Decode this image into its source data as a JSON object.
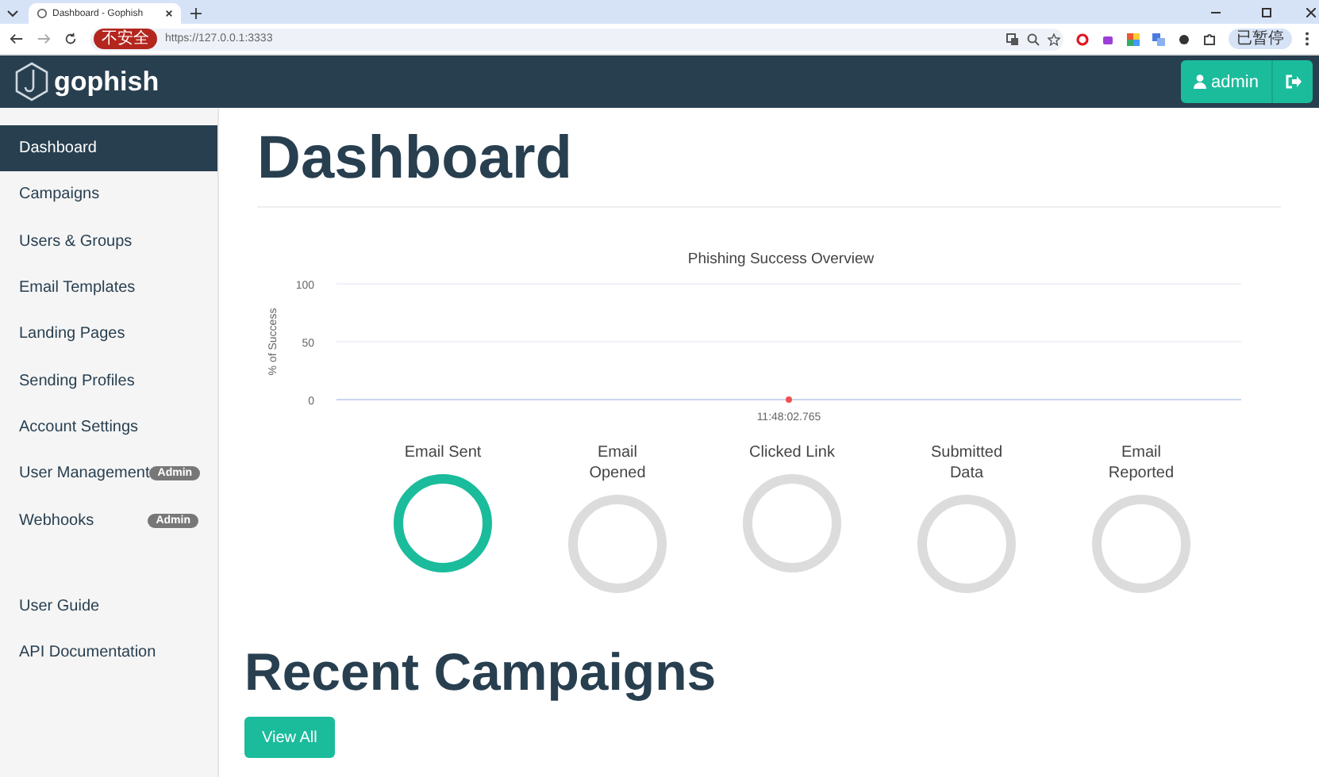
{
  "browser": {
    "tab_title": "Dashboard - Gophish",
    "security_badge": "不安全",
    "url": "https://127.0.0.1:3333",
    "profile": "已暂停"
  },
  "header": {
    "brand": "gophish",
    "user": "admin"
  },
  "sidebar": {
    "items": [
      {
        "label": "Dashboard",
        "selected": true
      },
      {
        "label": "Campaigns",
        "selected": false
      },
      {
        "label": "Users & Groups",
        "selected": false
      },
      {
        "label": "Email Templates",
        "selected": false
      },
      {
        "label": "Landing Pages",
        "selected": false
      },
      {
        "label": "Sending Profiles",
        "selected": false
      },
      {
        "label": "Account Settings",
        "selected": false
      },
      {
        "label": "User Management",
        "selected": false,
        "badge": "Admin"
      },
      {
        "label": "Webhooks",
        "selected": false,
        "badge": "Admin"
      }
    ],
    "links": [
      {
        "label": "User Guide"
      },
      {
        "label": "API Documentation"
      }
    ]
  },
  "page_title": "Dashboard",
  "overview": {
    "chart_data": {
      "type": "line",
      "title": "Phishing Success Overview",
      "ylabel": "% of Success",
      "categories": [
        "11:48:02.765"
      ],
      "series": [
        {
          "color": "#f05050",
          "marker": "circle",
          "values": [
            0
          ]
        }
      ],
      "ylim": [
        0,
        100
      ],
      "yticks": [
        0,
        50,
        100
      ]
    }
  },
  "stats": [
    {
      "label": "Email Sent",
      "color": "#1abc9c"
    },
    {
      "label": "Email Opened",
      "color": "#dcdcdc"
    },
    {
      "label": "Clicked Link",
      "color": "#dcdcdc"
    },
    {
      "label": "Submitted Data",
      "color": "#dcdcdc"
    },
    {
      "label": "Email Reported",
      "color": "#dcdcdc"
    }
  ],
  "recent": {
    "title": "Recent Campaigns",
    "button": "View All"
  }
}
